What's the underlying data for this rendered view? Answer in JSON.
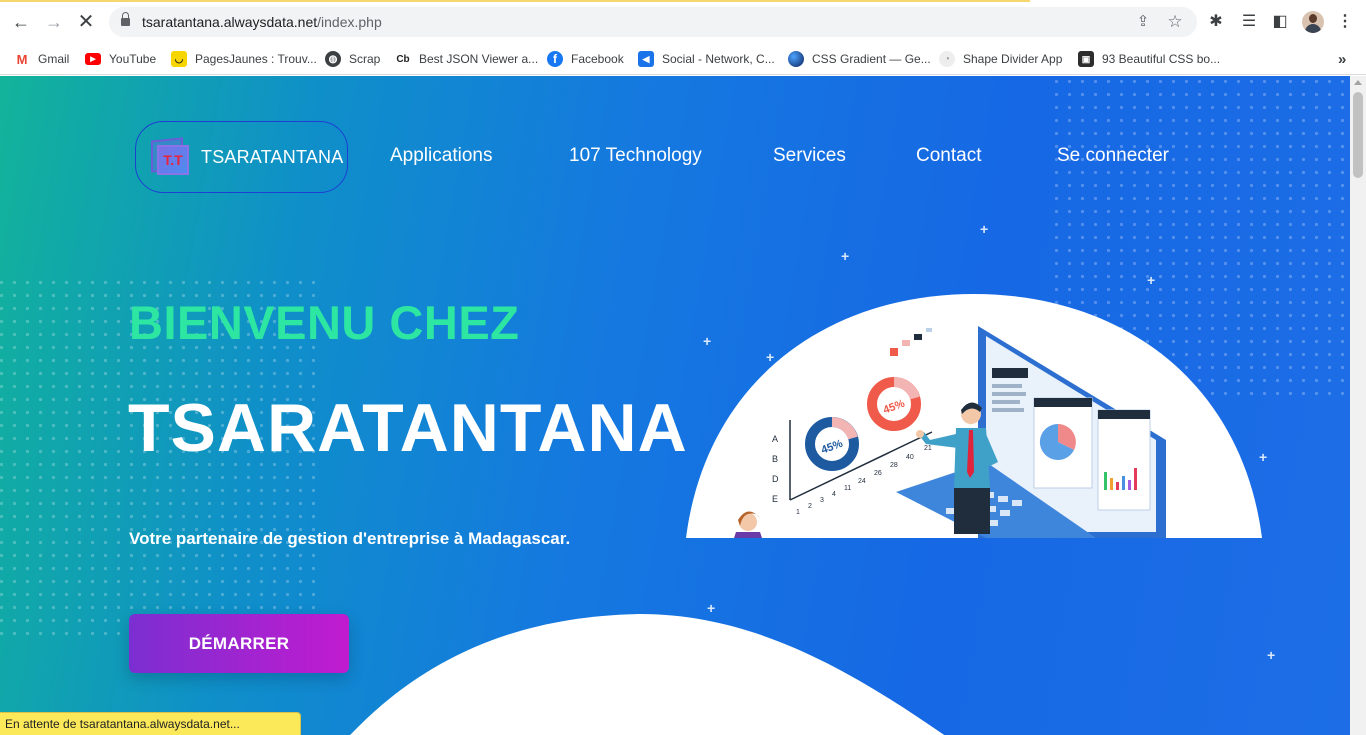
{
  "browser": {
    "url_host": "tsaratantana.alwaysdata.net",
    "url_path": "/index.php",
    "status_text": "En attente de tsaratantana.alwaysdata.net...",
    "bookmarks": [
      {
        "label": "Gmail",
        "icon": "gmail-icon",
        "color": "#ea4335",
        "glyph": "M"
      },
      {
        "label": "YouTube",
        "icon": "youtube-icon",
        "color": "#ff0000",
        "glyph": "▶"
      },
      {
        "label": "PagesJaunes : Trouv...",
        "icon": "pagesjaunes-icon",
        "color": "#f7d600",
        "glyph": "◡"
      },
      {
        "label": "Scrap",
        "icon": "globe-icon",
        "color": "#3c4043",
        "glyph": "◍"
      },
      {
        "label": "Best JSON Viewer a...",
        "icon": "codebeautify-icon",
        "color": "#ffffff",
        "glyph": "Cb"
      },
      {
        "label": "Facebook",
        "icon": "facebook-icon",
        "color": "#1877f2",
        "glyph": "f"
      },
      {
        "label": "Social - Network, C...",
        "icon": "social-icon",
        "color": "#1a73e8",
        "glyph": "◀"
      },
      {
        "label": "CSS Gradient — Ge...",
        "icon": "cssgradient-icon",
        "color": "#1a3b8f",
        "glyph": "●"
      },
      {
        "label": "Shape Divider App",
        "icon": "shapedivider-icon",
        "color": "#e8e8e8",
        "glyph": "◔"
      },
      {
        "label": "93 Beautiful CSS bo...",
        "icon": "cssbox-icon",
        "color": "#2d2d2d",
        "glyph": "▣"
      }
    ],
    "more_bookmarks": "»"
  },
  "site": {
    "logo_initials": "T.T",
    "logo_text": "TSARATANTANA",
    "nav": [
      "Applications",
      "107 Technology",
      "Services",
      "Contact",
      "Se connecter"
    ],
    "hero": {
      "kicker": "BIENVENU CHEZ",
      "title": "TSARATANTANA",
      "tagline": "Votre partenaire de gestion d'entreprise à Madagascar.",
      "cta": "DÉMARRER"
    },
    "illustration": {
      "donut_left": "45%",
      "donut_right": "45%",
      "axis_letters": [
        "A",
        "B",
        "D",
        "E"
      ],
      "axis_numbers": [
        "1",
        "2",
        "3",
        "4",
        "11",
        "24",
        "26",
        "28",
        "40",
        "21"
      ]
    },
    "colors": {
      "accent_green": "#2de6a2",
      "cta_start": "#7b2fd1",
      "cta_end": "#c11bcf",
      "bg_blue": "#1668e4"
    }
  }
}
